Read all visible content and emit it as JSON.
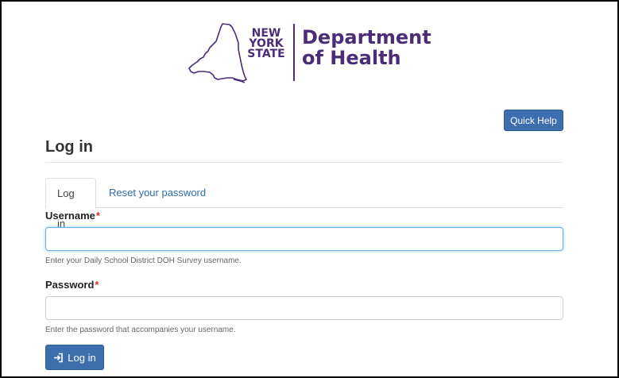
{
  "header": {
    "logo_ny_line1": "NEW",
    "logo_ny_line2": "YORK",
    "logo_ny_line3": "STATE",
    "logo_dept_line1": "Department",
    "logo_dept_line2": "of Health",
    "brand_color": "#4b2c79"
  },
  "toolbar": {
    "quick_help_label": "Quick Help"
  },
  "page": {
    "title": "Log in"
  },
  "tabs": [
    {
      "label": "Log in",
      "active": true
    },
    {
      "label": "Reset your password",
      "active": false
    }
  ],
  "form": {
    "username": {
      "label": "Username",
      "required_marker": "*",
      "value": "",
      "placeholder": "",
      "help": "Enter your Daily School District DOH Survey username."
    },
    "password": {
      "label": "Password",
      "required_marker": "*",
      "value": "",
      "placeholder": "",
      "help": "Enter the password that accompanies your username."
    },
    "submit_label": "Log in",
    "submit_icon": "log-in-icon"
  },
  "colors": {
    "button": "#3d6fae",
    "link": "#2f6ba5",
    "required": "#d9302c"
  }
}
